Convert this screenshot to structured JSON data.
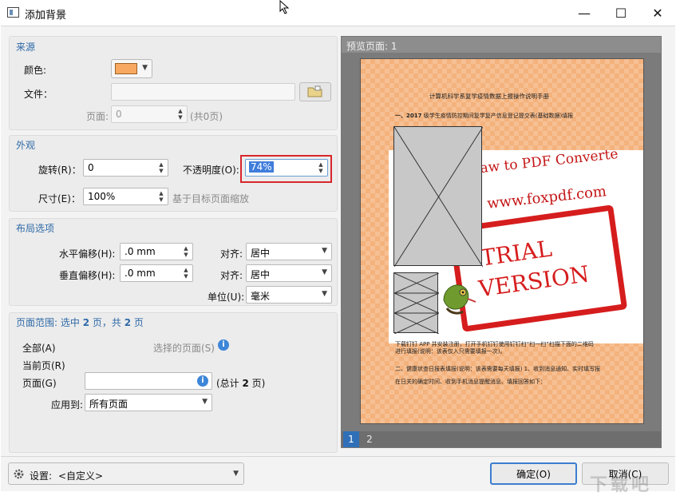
{
  "window": {
    "title": "添加背景",
    "minimize": "—",
    "maximize": "☐",
    "close": "✕"
  },
  "source": {
    "heading": "来源",
    "color_label": "颜色:",
    "color_value": "#f8a860",
    "file_label": "文件：",
    "file_value": "",
    "page_label": "页面:",
    "page_value": "0",
    "page_total": "(共0页)"
  },
  "appearance": {
    "heading": "外观",
    "rotation_label": "旋转(R)：",
    "rotation_value": "0",
    "opacity_label": "不透明度(O):",
    "opacity_value": "74%",
    "size_label": "尺寸(E)：",
    "size_value": "100%",
    "size_note": "基于目标页面缩放"
  },
  "layout": {
    "heading": "布局选项",
    "h_offset_label": "水平偏移(H):",
    "h_offset_value": ".0 mm",
    "h_align_label": "对齐:",
    "h_align_value": "居中",
    "v_offset_label": "垂直偏移(H):",
    "v_offset_value": ".0 mm",
    "v_align_label": "对齐:",
    "v_align_value": "居中",
    "unit_label": "单位(U):",
    "unit_value": "毫米"
  },
  "page_range": {
    "heading_pre": "页面范围: 选中 ",
    "selected": "2",
    "heading_mid": " 页，共 ",
    "total": "2",
    "heading_post": " 页",
    "all_label": "全部(A)",
    "selected_pages_label": "选择的页面(S)",
    "current_label": "当前页(R)",
    "pages_label": "页面(G)",
    "pages_value": "",
    "pages_total_pre": "(总计 ",
    "pages_total": "2",
    "pages_total_post": " 页)",
    "apply_label": "应用到:",
    "apply_value": "所有页面"
  },
  "preview": {
    "heading": "预览页面: 1",
    "doc_title": "计算机科学系复学疫情数据上报操作说明手册",
    "line1_bold": "一、2017",
    "line1_rest": " 级学生疫情防控期间复学复产信息登记提交表(基础数据)填报",
    "watermark_line1": "elDraw to PDF Converte",
    "watermark_line2": "www.foxpdf.com",
    "stamp_line1": "TRIAL",
    "stamp_line2": "VERSION",
    "line2": "下载钉钉 APP 并安装注册，打开手机钉钉使用钉钉扫“扫一扫”扫描下面的二维码",
    "line3": "进行填报(说明：该表仅入只需要填报一次)。",
    "line4": "二、健康状查日报表填报(说明：该表需要每天填报) 1、收到消息通知、实时填写报",
    "line5": "在日关的确定时间、收到手机消息提醒消息、填报回答如下：",
    "pages": [
      "1",
      "2"
    ]
  },
  "footer": {
    "settings_label": "设置:",
    "settings_value": "<自定义>",
    "ok_label": "确定(O)",
    "cancel_label": "取消(C)",
    "watermark_text": "下载吧"
  }
}
